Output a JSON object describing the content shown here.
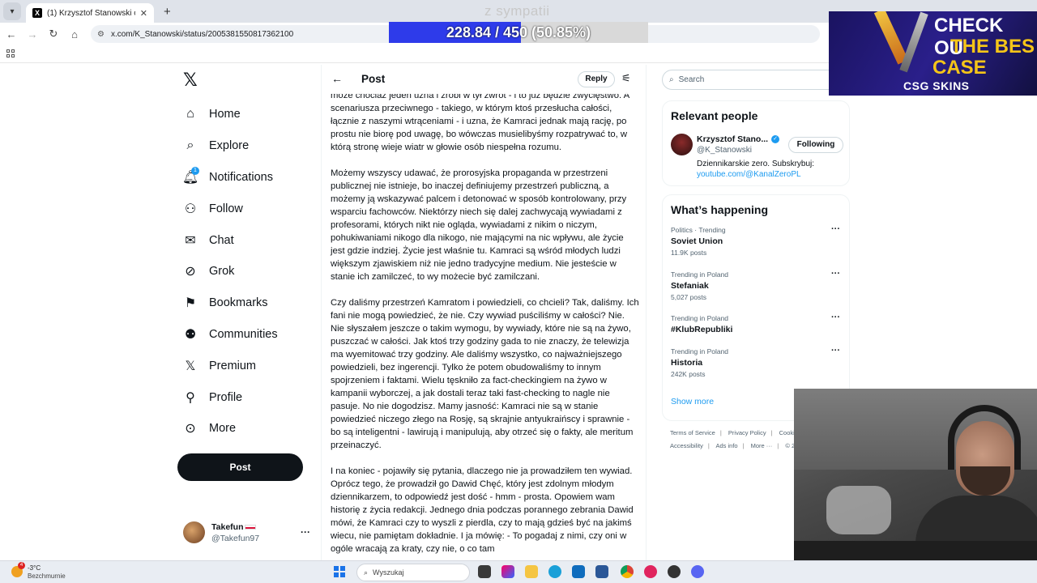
{
  "browser": {
    "tab_title": "(1) Krzysztof Stanowski on X: \"",
    "tab_favicon": "x-logo-icon",
    "new_tab": "+",
    "url": "x.com/K_Stanowski/status/2005381550817362100"
  },
  "overlay": {
    "sub_label": "z sympatii",
    "progress_text": "228.84 / 450 (50.85%)",
    "progress_fraction": 0.5085,
    "ad_line1": "CHECK OU",
    "ad_line2": "THE BES",
    "ad_line3": "CASE",
    "ad_brand": "CSG SKINS"
  },
  "sidebar": {
    "items": [
      {
        "label": "Home",
        "icon": "home-icon"
      },
      {
        "label": "Explore",
        "icon": "search-icon"
      },
      {
        "label": "Notifications",
        "icon": "bell-icon",
        "badge": "1"
      },
      {
        "label": "Follow",
        "icon": "person-add-icon"
      },
      {
        "label": "Chat",
        "icon": "mail-icon"
      },
      {
        "label": "Grok",
        "icon": "grok-icon"
      },
      {
        "label": "Bookmarks",
        "icon": "bookmark-icon"
      },
      {
        "label": "Communities",
        "icon": "communities-icon"
      },
      {
        "label": "Premium",
        "icon": "x-logo-icon"
      },
      {
        "label": "Profile",
        "icon": "person-icon"
      },
      {
        "label": "More",
        "icon": "more-circle-icon"
      }
    ],
    "post_button": "Post",
    "account": {
      "name": "Takefun",
      "handle": "@Takefun97",
      "more": "···"
    }
  },
  "post": {
    "header_title": "Post",
    "reply_label": "Reply",
    "paragraphs": [
      "może chociaż jeden uzna i zrobi w tył zwrot - i to już będzie zwycięstwo. A scenariusza przeciwnego - takiego, w którym ktoś przesłucha całości, łącznie z naszymi wtrąceniami - i uzna, że Kamraci jednak mają rację, po prostu nie biorę pod uwagę, bo wówczas musielibyśmy rozpatrywać to, w którą stronę wieje wiatr w głowie osób niespełna rozumu.",
      "Możemy wszyscy udawać, że prorosyjska propaganda w przestrzeni publicznej nie istnieje, bo inaczej definiujemy przestrzeń publiczną, a możemy ją wskazywać palcem i detonować w sposób kontrolowany, przy wsparciu fachowców. Niektórzy niech się dalej zachwycają wywiadami z profesorami, których nikt nie ogląda, wywiadami z nikim o niczym, pohukiwaniami nikogo dla nikogo, nie mającymi na nic wpływu, ale życie jest gdzie indziej. Życie jest właśnie tu. Kamraci są wśród młodych ludzi większym zjawiskiem niż nie jedno tradycyjne medium. Nie jesteście w stanie ich zamilczeć, to wy możecie być zamilczani.",
      "Czy daliśmy przestrzeń Kamratom i powiedzieli, co chcieli? Tak, daliśmy. Ich fani nie mogą powiedzieć, że nie. Czy wywiad puściliśmy w całości? Nie. Nie słyszałem jeszcze o takim wymogu, by wywiady, które nie są na żywo, puszczać w całości. Jak ktoś trzy godziny gada to nie znaczy, że telewizja ma wyemitować trzy godziny. Ale daliśmy wszystko, co najważniejszego powiedzieli, bez ingerencji. Tylko że potem obudowaliśmy to innym spojrzeniem i faktami. Wielu tęskniło za fact-checkingiem na żywo w kampanii wyborczej, a jak dostali teraz taki fast-checking to nagle nie pasuje. No nie dogodzisz. Mamy jasność: Kamraci nie są w stanie powiedzieć niczego złego na Rosję, są skrajnie antyukraińscy i sprawnie - bo są inteligentni - lawirują i manipulują, aby otrzeć się o fakty, ale meritum przeinaczyć.",
      "I na koniec - pojawiły się pytania, dlaczego nie ja prowadziłem ten wywiad. Oprócz tego, że prowadził go Dawid Chęć, który jest zdolnym młodym dziennikarzem, to odpowiedź jest dość - hmm - prosta. Opowiem wam historię z życia redakcji. Jednego dnia podczas porannego zebrania Dawid mówi, że Kamraci czy to wyszli z pierdla, czy to mają gdzieś być na jakimś wiecu, nie pamiętam dokładnie. I ja mówię: - To pogadaj z nimi, czy oni w ogóle wracają za kraty, czy nie, o co tam"
    ]
  },
  "right": {
    "search_placeholder": "Search",
    "relevant_title": "Relevant people",
    "person": {
      "name": "Krzysztof Stano...",
      "handle": "@K_Stanowski",
      "follow_label": "Following",
      "bio": "Dziennikarskie zero. Subskrybuj:",
      "bio_link": "youtube.com/@KanalZeroPL"
    },
    "happening_title": "What’s happening",
    "trends": [
      {
        "context": "Politics · Trending",
        "name": "Soviet Union",
        "count": "11.9K posts"
      },
      {
        "context": "Trending in Poland",
        "name": "Stefaniak",
        "count": "5,027 posts"
      },
      {
        "context": "Trending in Poland",
        "name": "#KlubRepubliki",
        "count": ""
      },
      {
        "context": "Trending in Poland",
        "name": "Historia",
        "count": "242K posts"
      }
    ],
    "show_more": "Show more",
    "footer": {
      "terms": "Terms of Service",
      "privacy": "Privacy Policy",
      "cookie": "Cooki",
      "accessibility": "Accessibility",
      "ads": "Ads info",
      "more": "More ···",
      "copy": "© 20"
    }
  },
  "taskbar": {
    "temperature": "-3°C",
    "condition": "Bezchmurnie",
    "weather_badge": "4",
    "search_placeholder": "Wyszukaj"
  },
  "colors": {
    "accent": "#1d9bf0",
    "progress_fill": "#2e3bea",
    "text": "#0f1419",
    "muted": "#536471"
  }
}
